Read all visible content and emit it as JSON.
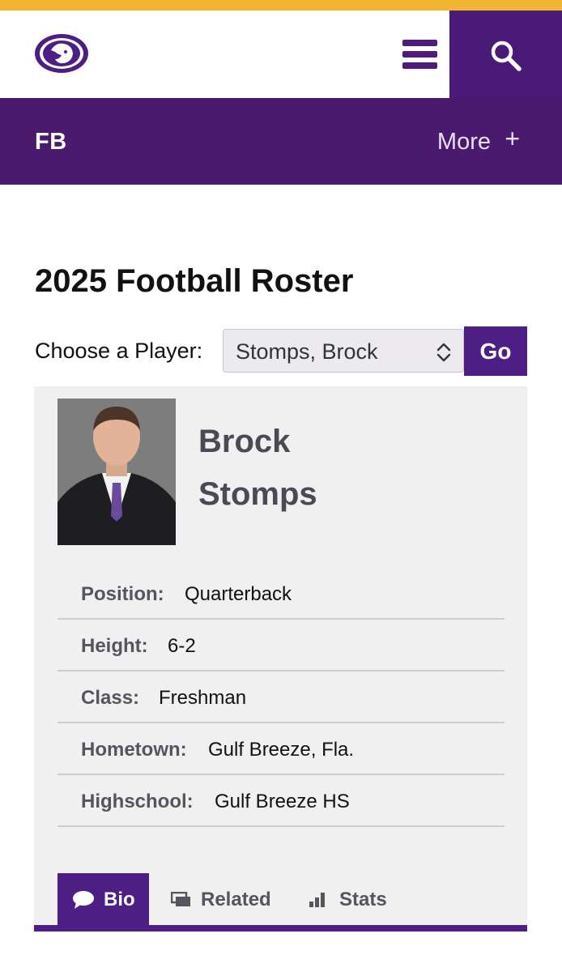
{
  "header": {
    "logo_name": "tiger-logo",
    "menu_icon": "hamburger-menu-icon",
    "search_icon": "search-icon"
  },
  "nav": {
    "section": "FB",
    "more_label": "More",
    "more_icon": "+"
  },
  "page": {
    "title": "2025 Football Roster"
  },
  "chooser": {
    "label": "Choose a Player:",
    "selected": "Stomps, Brock",
    "go_label": "Go"
  },
  "player": {
    "first_name": "Brock",
    "last_name": "Stomps",
    "details": [
      {
        "label": "Position:",
        "value": "Quarterback"
      },
      {
        "label": "Height:",
        "value": "6-2"
      },
      {
        "label": "Class:",
        "value": "Freshman"
      },
      {
        "label": "Hometown:",
        "value": "Gulf Breeze, Fla."
      },
      {
        "label": "Highschool:",
        "value": "Gulf Breeze HS"
      }
    ]
  },
  "tabs": [
    {
      "label": "Bio",
      "icon": "speech-bubble-icon",
      "active": true
    },
    {
      "label": "Related",
      "icon": "stacked-cards-icon",
      "active": false
    },
    {
      "label": "Stats",
      "icon": "bar-chart-icon",
      "active": false
    }
  ],
  "colors": {
    "accent_gold": "#f2b531",
    "brand_purple": "#4a1a6e",
    "button_purple": "#4d1e84"
  }
}
